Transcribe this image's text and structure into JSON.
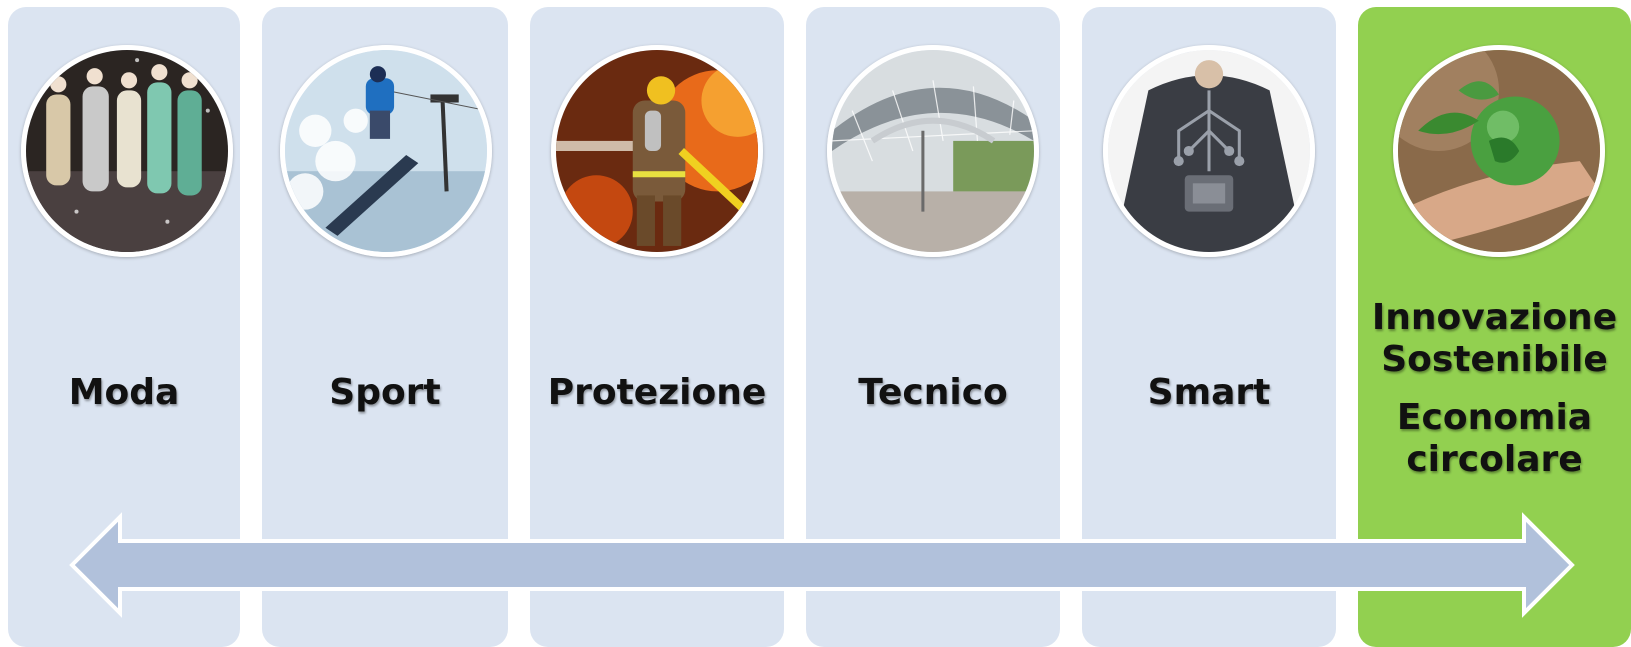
{
  "colors": {
    "panel": "#dbe4f1",
    "panel_highlight": "#92d050",
    "arrow_fill": "#b1c1db",
    "arrow_stroke": "#ffffff"
  },
  "panels": [
    {
      "id": "moda",
      "label": "Moda",
      "image": "fashion-runway-photo",
      "highlight": false
    },
    {
      "id": "sport",
      "label": "Sport",
      "image": "snowboarder-photo",
      "highlight": false
    },
    {
      "id": "protezione",
      "label": "Protezione",
      "image": "firefighter-photo",
      "highlight": false
    },
    {
      "id": "tecnico",
      "label": "Tecnico",
      "image": "tensile-roof-structure-photo",
      "highlight": false
    },
    {
      "id": "smart",
      "label": "Smart",
      "image": "smart-garment-circuit-photo",
      "highlight": false
    },
    {
      "id": "innovazione",
      "label_lines": [
        "Innovazione",
        "Sostenibile"
      ],
      "label_lines_2": [
        "Economia",
        "circolare"
      ],
      "image": "hand-holding-glass-globe-photo",
      "highlight": true
    }
  ],
  "arrow": {
    "direction": "double-headed-horizontal"
  }
}
